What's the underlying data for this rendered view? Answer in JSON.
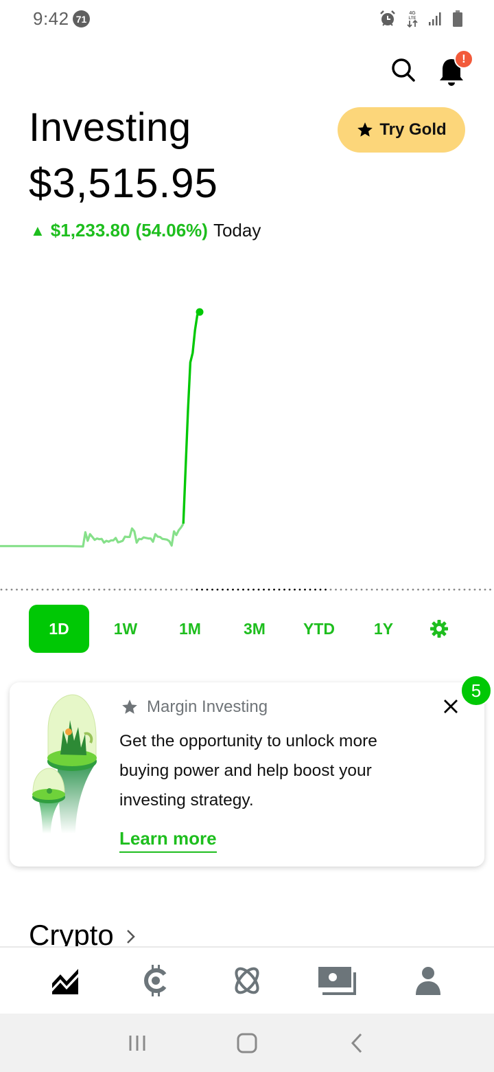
{
  "status_bar": {
    "time": "9:42",
    "notification_count": "71",
    "icons": [
      "alarm-icon",
      "lte-data-icon",
      "signal-icon",
      "battery-icon"
    ],
    "network_label": "4G LTE"
  },
  "header": {
    "search_icon": "search-icon",
    "notifications_icon": "bell-icon",
    "notification_badge": "!"
  },
  "page": {
    "title": "Investing",
    "portfolio_value": "$3,515.95",
    "change_arrow": "▲",
    "change_amount": "$1,233.80",
    "change_percent": "(54.06%)",
    "change_period": "Today"
  },
  "gold_button": {
    "icon": "star-icon",
    "label": "Try Gold"
  },
  "colors": {
    "brand_green": "#00c805",
    "text_green": "#1ebe1e",
    "chart_light": "#86e08a",
    "gold": "#fcd67a",
    "badge_red": "#f25a3a",
    "icon_gray": "#6c757a"
  },
  "chart_data": {
    "type": "line",
    "title": "",
    "xlabel": "",
    "ylabel": "",
    "grid": false,
    "description": "Intraday portfolio value (1D). Flat before market open, choppy trading, then sharp spike near end; highlighted most-recent segment in bright green.",
    "x": [
      0,
      1,
      2,
      3,
      4,
      5,
      6,
      7,
      8,
      9,
      10,
      11,
      12,
      13,
      14,
      15,
      16,
      17,
      18,
      19,
      20,
      21,
      22,
      23,
      24,
      25,
      26,
      27,
      28,
      29,
      30,
      31,
      32,
      33,
      34,
      35,
      36,
      37,
      38,
      39,
      40,
      41,
      42,
      43,
      44,
      45,
      46,
      47,
      48,
      49,
      50,
      51,
      52,
      53,
      54,
      55
    ],
    "series": [
      {
        "name": "Portfolio value",
        "values": [
          2282,
          2282,
          2282,
          2282,
          2282,
          2280,
          2355,
          2310,
          2345,
          2330,
          2315,
          2322,
          2318,
          2320,
          2300,
          2310,
          2305,
          2312,
          2312,
          2325,
          2302,
          2305,
          2310,
          2332,
          2330,
          2330,
          2375,
          2360,
          2300,
          2320,
          2318,
          2328,
          2325,
          2322,
          2322,
          2305,
          2345,
          2332,
          2330,
          2320,
          2318,
          2316,
          2308,
          2285,
          2360,
          2340,
          2365,
          2380,
          2400,
          2700,
          3000,
          3250,
          3300,
          3420,
          3500,
          3516
        ]
      }
    ],
    "highlight_from_index": 48,
    "end_marker": true,
    "reference_line": "dotted horizontal baseline (previous close)"
  },
  "range_tabs": {
    "items": [
      {
        "label": "1D",
        "active": true
      },
      {
        "label": "1W",
        "active": false
      },
      {
        "label": "1M",
        "active": false
      },
      {
        "label": "3M",
        "active": false
      },
      {
        "label": "YTD",
        "active": false
      },
      {
        "label": "1Y",
        "active": false
      }
    ],
    "settings_icon": "gear-icon"
  },
  "promo_card": {
    "eyebrow": "Margin Investing",
    "body": "Get the opportunity to unlock more buying power and help boost your investing strategy.",
    "link": "Learn more",
    "count_badge": "5",
    "close_icon": "close-icon"
  },
  "crypto": {
    "heading": "Crypto"
  },
  "bottom_nav": {
    "items": [
      {
        "name": "investing",
        "icon": "chart-icon",
        "active": true
      },
      {
        "name": "crypto",
        "icon": "crypto-coin-icon",
        "active": false
      },
      {
        "name": "browse",
        "icon": "orbit-icon",
        "active": false
      },
      {
        "name": "cash",
        "icon": "cash-icon",
        "active": false
      },
      {
        "name": "account",
        "icon": "person-icon",
        "active": false
      }
    ]
  },
  "system_nav": {
    "items": [
      "recents-icon",
      "home-icon",
      "back-icon"
    ]
  }
}
